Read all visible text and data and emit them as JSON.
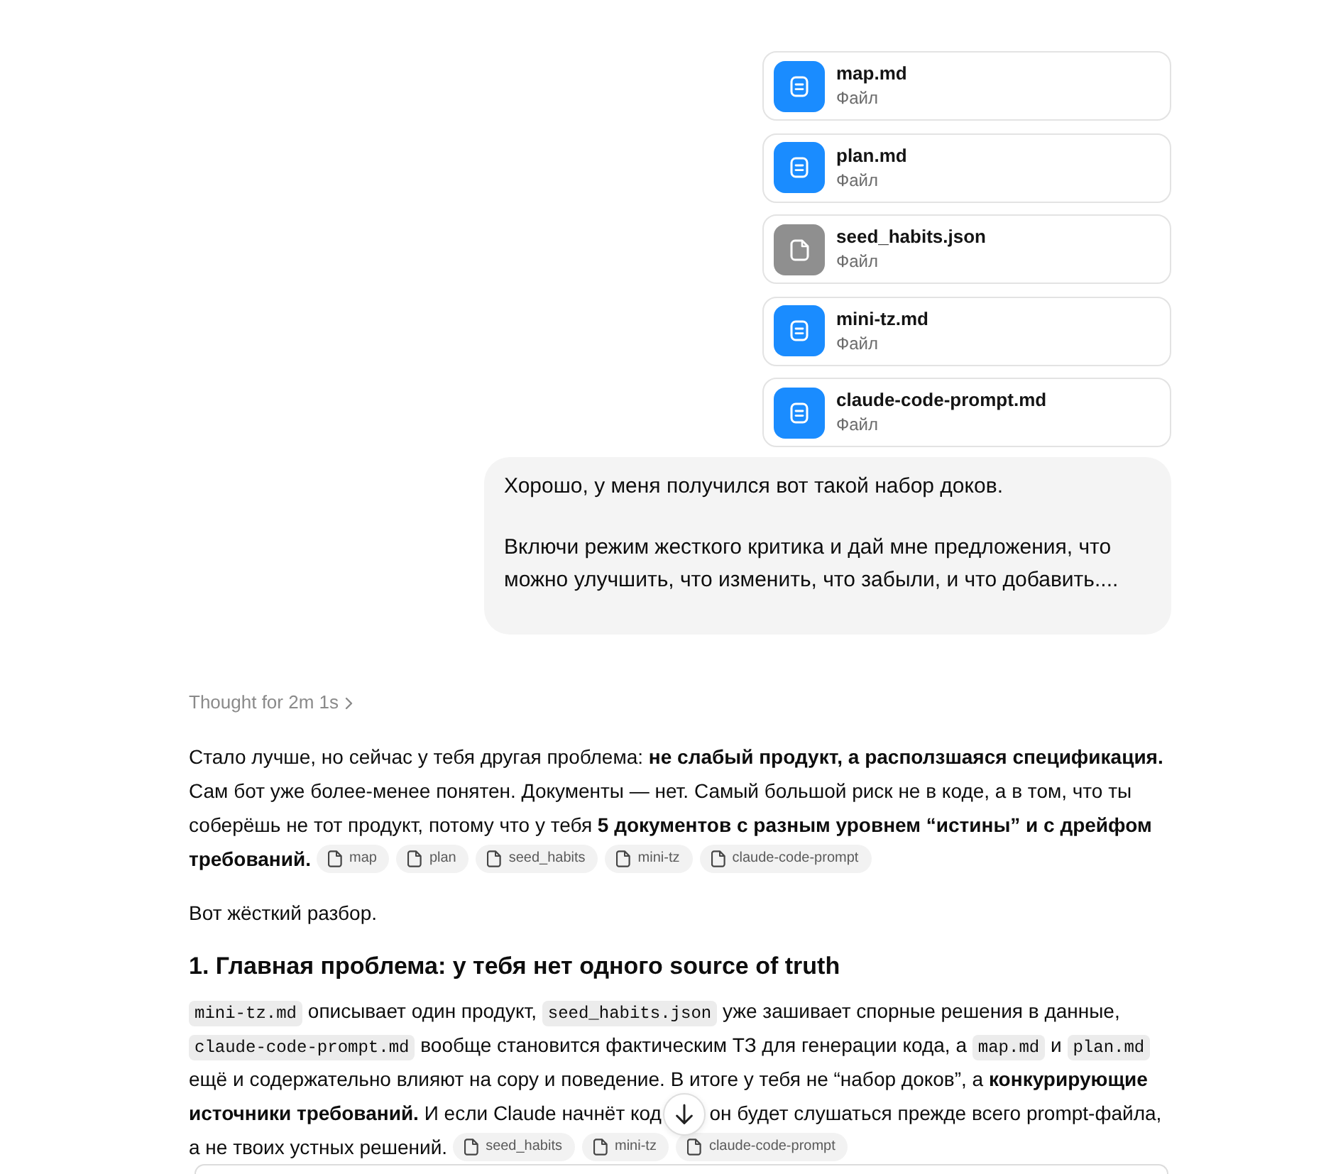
{
  "attachments": [
    {
      "name": "map.md",
      "subtitle": "Файл",
      "kind": "text"
    },
    {
      "name": "plan.md",
      "subtitle": "Файл",
      "kind": "text"
    },
    {
      "name": "seed_habits.json",
      "subtitle": "Файл",
      "kind": "data"
    },
    {
      "name": "mini-tz.md",
      "subtitle": "Файл",
      "kind": "text"
    },
    {
      "name": "claude-code-prompt.md",
      "subtitle": "Файл",
      "kind": "text"
    }
  ],
  "user_message": {
    "paragraphs": [
      "Хорошо, у меня получился вот такой набор доков.",
      "Включи режим жесткого критика и дай мне предложения, что можно улучшить, что изменить, что забыли, и что добавить...."
    ]
  },
  "thought": {
    "label": "Thought for 2m 1s"
  },
  "response": {
    "blocks": [
      {
        "kind": "paragraph",
        "lines": [
          [
            {
              "kind": "text",
              "text": "Стало лучше, но сейчас у тебя другая проблема: **не слабый продукт, а расползшаяся спецификация.**"
            }
          ],
          [
            {
              "kind": "text",
              "text": "Сам бот уже более-менее понятен. Документы — нет. Самый большой риск не в коде, а в том, что ты"
            }
          ],
          [
            {
              "kind": "text",
              "text": "соберёшь не тот продукт, потому что у тебя **5 документов с разным уровнем “истины” и с дрейфом**"
            }
          ],
          [
            {
              "kind": "text",
              "text": "**требований.**"
            }
          ]
        ],
        "sources": [
          "map",
          "plan",
          "seed_habits",
          "mini-tz",
          "claude-code-prompt"
        ]
      },
      {
        "kind": "paragraph",
        "lines": [
          [
            {
              "kind": "text",
              "text": "Вот жёсткий разбор."
            }
          ]
        ]
      },
      {
        "kind": "heading",
        "text": "1. Главная проблема: у тебя нет одного source of truth"
      },
      {
        "kind": "paragraph",
        "lines": [
          [
            {
              "kind": "code",
              "text": "mini-tz.md"
            },
            {
              "kind": "text",
              "text": "описывает один продукт,"
            },
            {
              "kind": "code",
              "text": "seed_habits.json"
            },
            {
              "kind": "text",
              "text": "уже зашивает спорные решения в данные,"
            }
          ],
          [
            {
              "kind": "code",
              "text": "claude-code-prompt.md"
            },
            {
              "kind": "text",
              "text": "вообще становится фактическим ТЗ для генерации кода, а"
            },
            {
              "kind": "code",
              "text": "map.md"
            },
            {
              "kind": "text",
              "text": "и"
            },
            {
              "kind": "code",
              "text": "plan.md"
            }
          ],
          [
            {
              "kind": "text",
              "text": "ещё и содержательно влияют на copy и поведение. В итоге у тебя не “набор доков”, а **конкурирующие**"
            }
          ],
          [
            {
              "kind": "text",
              "text": "**источники требований.** И если Claude начнёт код"
            },
            {
              "kind": "covered"
            },
            {
              "kind": "text",
              "text": "он будет слушаться прежде всего prompt-файла,"
            }
          ],
          [
            {
              "kind": "text",
              "text": "а не твоих устных решений."
            }
          ]
        ],
        "sources": [
          "seed_habits",
          "mini-tz",
          "claude-code-prompt"
        ]
      }
    ]
  }
}
